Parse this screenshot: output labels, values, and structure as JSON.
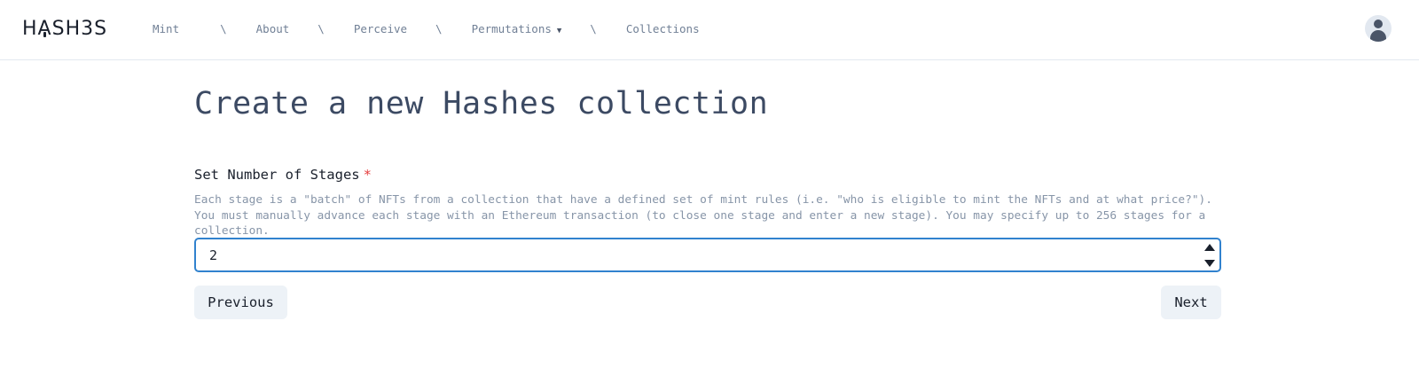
{
  "header": {
    "logo_text": "HASH3S",
    "logo_parts": [
      "H",
      "A",
      "SH3S"
    ],
    "nav_items": [
      {
        "label": "Mint"
      },
      {
        "label": "About"
      },
      {
        "label": "Perceive"
      },
      {
        "label": "Permutations",
        "caret": "▼"
      },
      {
        "label": "Collections"
      }
    ],
    "separator": "\\",
    "avatar_icon": "user-avatar-icon"
  },
  "page": {
    "title": "Create a new Hashes collection"
  },
  "form": {
    "stages_label": "Set Number of Stages",
    "required_mark": "*",
    "stages_help": "Each stage is a \"batch\" of NFTs from a collection that have a defined set of mint rules (i.e. \"who is eligible to mint the NFTs and at what price?\"). You must manually advance each stage with an Ethereum transaction (to close one stage and enter a new stage). You may specify up to 256 stages for a collection.",
    "stages_value": "2"
  },
  "actions": {
    "previous_label": "Previous",
    "next_label": "Next"
  },
  "colors": {
    "accent_focus": "#3182ce",
    "required": "#e53e3e",
    "button_bg": "#edf2f7",
    "nav_text": "#718096",
    "help_text": "#8795a8"
  }
}
